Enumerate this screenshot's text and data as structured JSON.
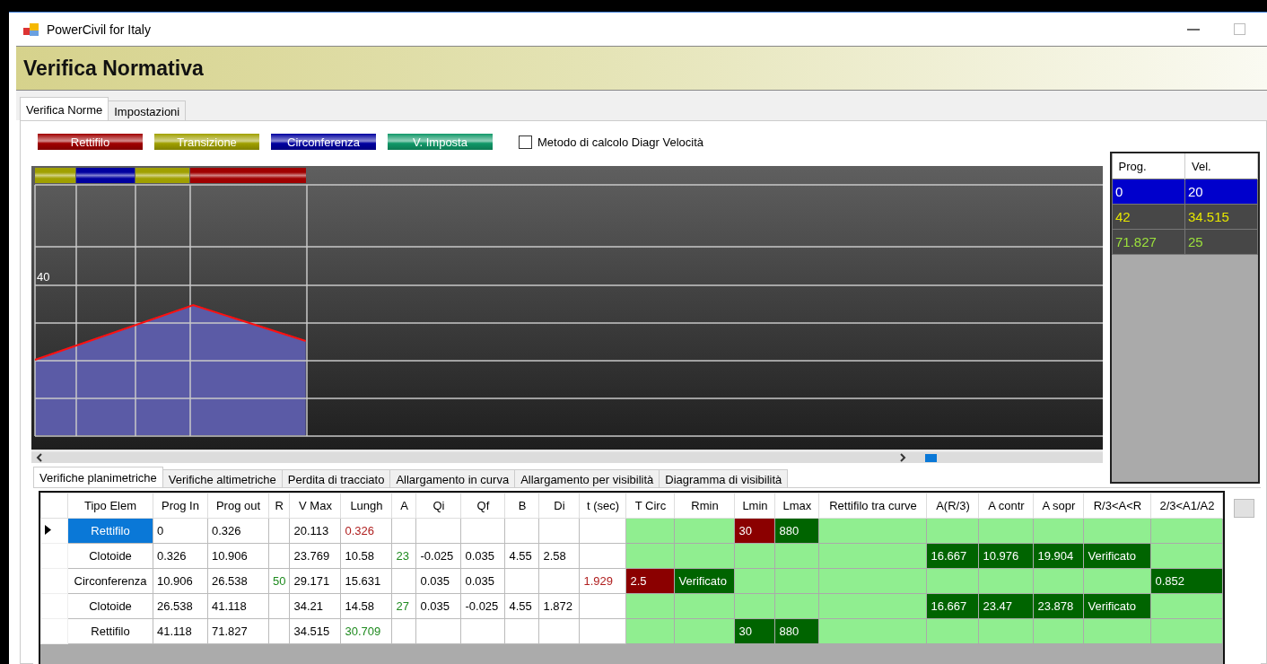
{
  "window": {
    "title": "PowerCivil for Italy"
  },
  "header": {
    "title": "Verifica Normativa"
  },
  "tabs": [
    {
      "label": "Verifica Norme",
      "selected": true
    },
    {
      "label": "Impostazioni",
      "selected": false
    }
  ],
  "legend": [
    {
      "label": "Rettifilo",
      "color": "#a00000"
    },
    {
      "label": "Transizione",
      "color": "#a0a000"
    },
    {
      "label": "Circonferenza",
      "color": "#0000a0"
    },
    {
      "label": "V. Imposta",
      "color": "#109868"
    }
  ],
  "method_checkbox": {
    "label": "Metodo di calcolo Diagr Velocità",
    "checked": false
  },
  "chart": {
    "axis_label": "40",
    "segments": [
      {
        "color": "#a0a000"
      },
      {
        "color": "#0000a0"
      },
      {
        "color": "#a0a000"
      },
      {
        "color": "#a00000"
      }
    ]
  },
  "speed_table": {
    "columns": [
      "Prog.",
      "Vel."
    ],
    "rows": [
      {
        "cells": [
          "0",
          "20"
        ],
        "selected": true,
        "color": "#ffffff"
      },
      {
        "cells": [
          "42",
          "34.515"
        ],
        "selected": false,
        "color": "#e6e600"
      },
      {
        "cells": [
          "71.827",
          "25"
        ],
        "selected": false,
        "color": "#9be03c"
      }
    ]
  },
  "check_tabs": [
    {
      "label": "Verifiche planimetriche",
      "selected": true
    },
    {
      "label": "Verifiche altimetriche",
      "selected": false
    },
    {
      "label": "Perdita di tracciato",
      "selected": false
    },
    {
      "label": "Allargamento in curva",
      "selected": false
    },
    {
      "label": "Allargamento per visibilità",
      "selected": false
    },
    {
      "label": "Diagramma di visibilità",
      "selected": false
    }
  ],
  "grid": {
    "columns": [
      "Tipo Elem",
      "Prog In",
      "Prog out",
      "R",
      "V Max",
      "Lungh",
      "A",
      "Qi",
      "Qf",
      "B",
      "Di",
      "t (sec)",
      "T Circ",
      "Rmin",
      "Lmin",
      "Lmax",
      "Rettifilo tra curve",
      "A(R/3)",
      "A contr",
      "A sopr",
      "R/3<A<R",
      "2/3<A1/A2"
    ],
    "rows": [
      {
        "selected": true,
        "cells": [
          {
            "text": "Rettifilo"
          },
          {
            "text": "0"
          },
          {
            "text": "0.326"
          },
          null,
          {
            "text": "20.113"
          },
          {
            "text": "0.326",
            "kind": "warn"
          },
          null,
          null,
          null,
          null,
          null,
          null,
          {
            "kind": "field"
          },
          {
            "kind": "field"
          },
          {
            "text": "30",
            "kind": "fail"
          },
          {
            "text": "880",
            "kind": "pass"
          },
          {
            "kind": "field"
          },
          {
            "kind": "field"
          },
          {
            "kind": "field"
          },
          {
            "kind": "field"
          },
          {
            "kind": "field"
          },
          {
            "kind": "field"
          }
        ]
      },
      {
        "selected": false,
        "cells": [
          {
            "text": "Clotoide"
          },
          {
            "text": "0.326"
          },
          {
            "text": "10.906"
          },
          null,
          {
            "text": "23.769"
          },
          {
            "text": "10.58"
          },
          {
            "text": "23",
            "kind": "ok"
          },
          {
            "text": "-0.025"
          },
          {
            "text": "0.035"
          },
          {
            "text": "4.55"
          },
          {
            "text": "2.58"
          },
          null,
          {
            "kind": "field"
          },
          {
            "kind": "field"
          },
          {
            "kind": "field"
          },
          {
            "kind": "field"
          },
          {
            "kind": "field"
          },
          {
            "text": "16.667",
            "kind": "pass"
          },
          {
            "text": "10.976",
            "kind": "pass"
          },
          {
            "text": "19.904",
            "kind": "pass"
          },
          {
            "text": "Verificato",
            "kind": "pass"
          },
          {
            "kind": "field"
          }
        ]
      },
      {
        "selected": false,
        "cells": [
          {
            "text": "Circonferenza"
          },
          {
            "text": "10.906"
          },
          {
            "text": "26.538"
          },
          {
            "text": "50",
            "kind": "ok"
          },
          {
            "text": "29.171"
          },
          {
            "text": "15.631"
          },
          null,
          {
            "text": "0.035"
          },
          {
            "text": "0.035"
          },
          null,
          null,
          {
            "text": "1.929",
            "kind": "warn"
          },
          {
            "text": "2.5",
            "kind": "fail"
          },
          {
            "text": "Verificato",
            "kind": "pass"
          },
          {
            "kind": "field"
          },
          {
            "kind": "field"
          },
          {
            "kind": "field"
          },
          {
            "kind": "field"
          },
          {
            "kind": "field"
          },
          {
            "kind": "field"
          },
          {
            "kind": "field"
          },
          {
            "text": "0.852",
            "kind": "pass"
          }
        ]
      },
      {
        "selected": false,
        "cells": [
          {
            "text": "Clotoide"
          },
          {
            "text": "26.538"
          },
          {
            "text": "41.118"
          },
          null,
          {
            "text": "34.21"
          },
          {
            "text": "14.58"
          },
          {
            "text": "27",
            "kind": "ok"
          },
          {
            "text": "0.035"
          },
          {
            "text": "-0.025"
          },
          {
            "text": "4.55"
          },
          {
            "text": "1.872"
          },
          null,
          {
            "kind": "field"
          },
          {
            "kind": "field"
          },
          {
            "kind": "field"
          },
          {
            "kind": "field"
          },
          {
            "kind": "field"
          },
          {
            "text": "16.667",
            "kind": "pass"
          },
          {
            "text": "23.47",
            "kind": "pass"
          },
          {
            "text": "23.878",
            "kind": "pass"
          },
          {
            "text": "Verificato",
            "kind": "pass"
          },
          {
            "kind": "field"
          }
        ]
      },
      {
        "selected": false,
        "cells": [
          {
            "text": "Rettifilo"
          },
          {
            "text": "41.118"
          },
          {
            "text": "71.827"
          },
          null,
          {
            "text": "34.515"
          },
          {
            "text": "30.709",
            "kind": "ok"
          },
          null,
          null,
          null,
          null,
          null,
          null,
          {
            "kind": "field"
          },
          {
            "kind": "field"
          },
          {
            "text": "30",
            "kind": "pass"
          },
          {
            "text": "880",
            "kind": "pass"
          },
          {
            "kind": "field"
          },
          {
            "kind": "field"
          },
          {
            "kind": "field"
          },
          {
            "kind": "field"
          },
          {
            "kind": "field"
          },
          {
            "kind": "field"
          }
        ]
      }
    ]
  }
}
